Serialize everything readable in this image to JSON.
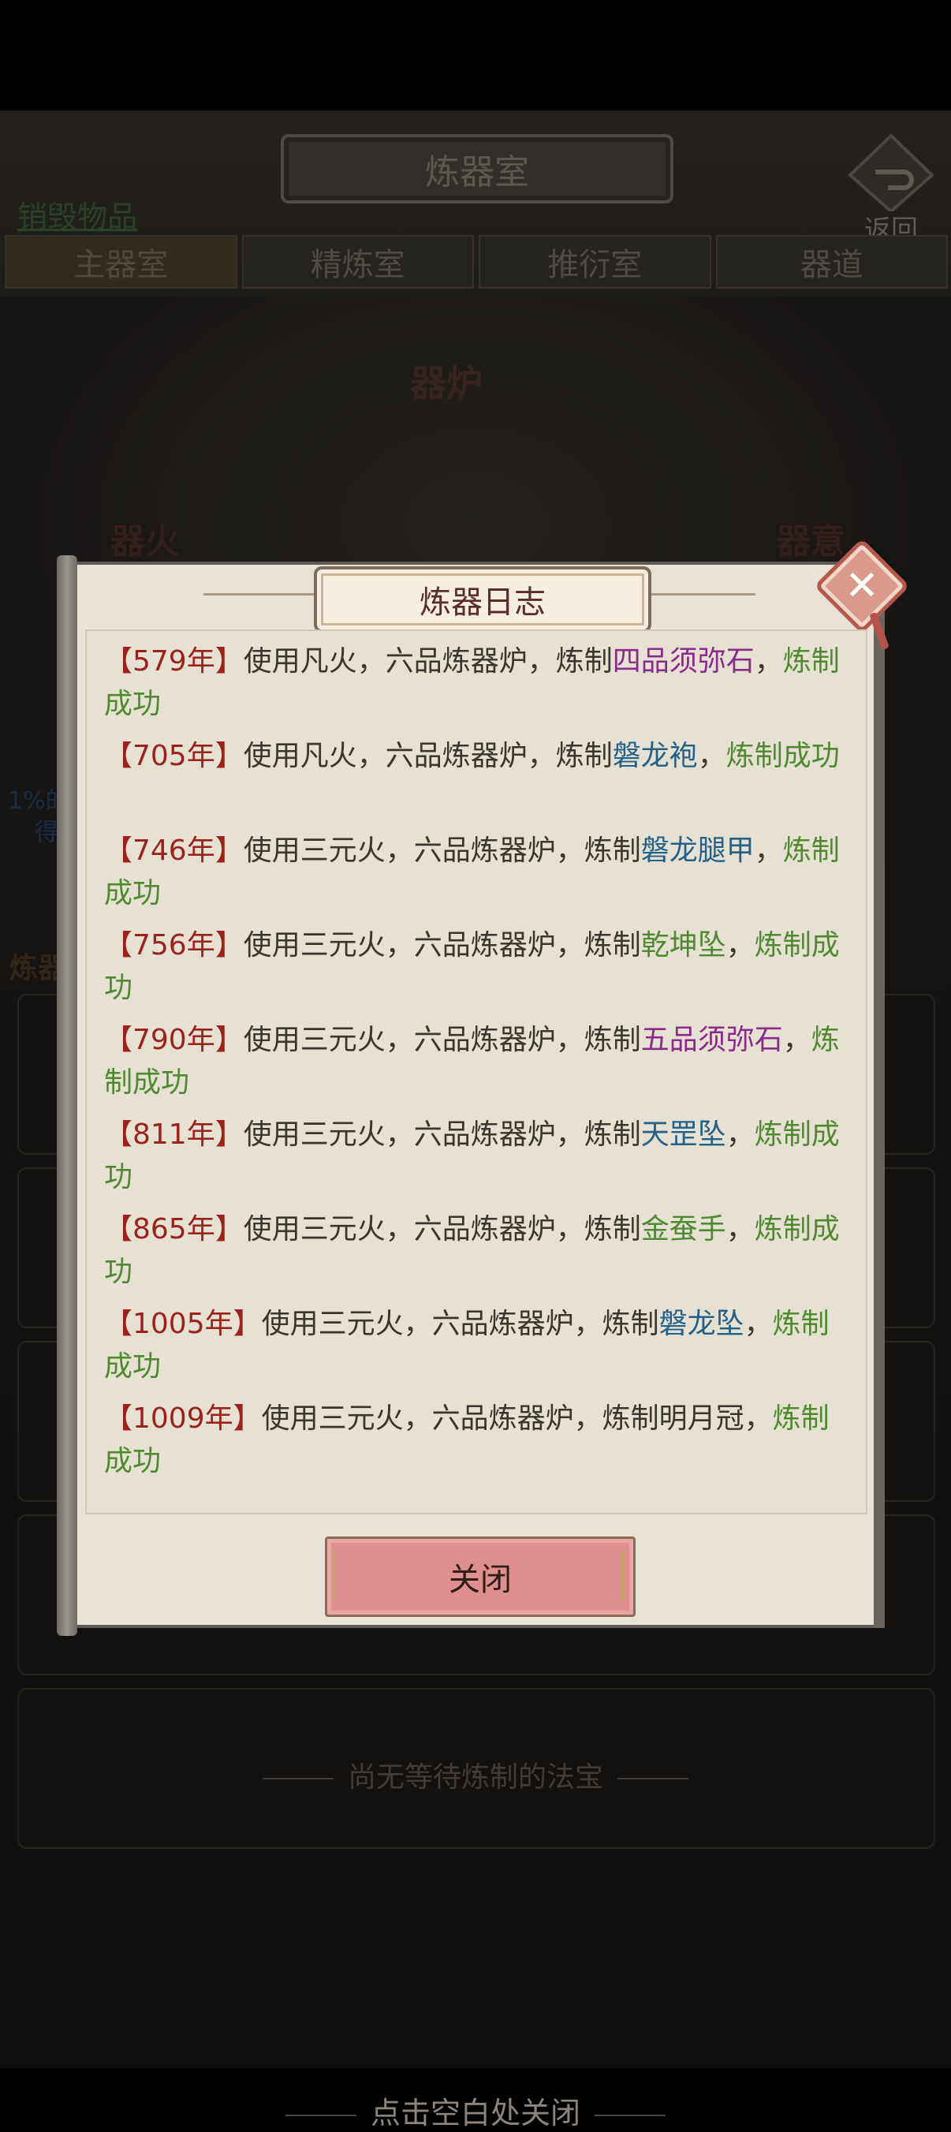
{
  "app": {
    "title": "炼器室",
    "back_label": "返回",
    "destroy_link": "销毁物品",
    "tabs": [
      "主器室",
      "精炼室",
      "推衍室",
      "器道"
    ],
    "furnace_label": "器炉",
    "fire_label": "器火",
    "essence_label": "器意",
    "hint_line_1": "1%的",
    "hint_line_2": "得",
    "section_label": "炼器",
    "empty_queue_text": "尚无等待炼制的法宝",
    "tap_to_close": "点击空白处关闭"
  },
  "dialog": {
    "title": "炼器日志",
    "close_button_label": "关闭",
    "entries": [
      {
        "year": "【579年】",
        "pre": "使用凡火，六品炼器炉，炼制",
        "item": "四品须弥石",
        "item_color": "purple",
        "post": "，",
        "result": "炼制成功"
      },
      {
        "year": "【705年】",
        "pre": "使用凡火，六品炼器炉，炼制",
        "item": "磐龙袍",
        "item_color": "blue",
        "post": "，",
        "result": "炼制成功"
      },
      {
        "year": "【746年】",
        "pre": "使用三元火，六品炼器炉，炼制",
        "item": "磐龙腿甲",
        "item_color": "blue",
        "post": "，",
        "result": "炼制成功"
      },
      {
        "year": "【756年】",
        "pre": "使用三元火，六品炼器炉，炼制",
        "item": "乾坤坠",
        "item_color": "green",
        "post": "，",
        "result": "炼制成功"
      },
      {
        "year": "【790年】",
        "pre": "使用三元火，六品炼器炉，炼制",
        "item": "五品须弥石",
        "item_color": "purple",
        "post": "，",
        "result": "炼制成功"
      },
      {
        "year": "【811年】",
        "pre": "使用三元火，六品炼器炉，炼制",
        "item": "天罡坠",
        "item_color": "blue",
        "post": "，",
        "result": "炼制成功"
      },
      {
        "year": "【865年】",
        "pre": "使用三元火，六品炼器炉，炼制",
        "item": "金蚕手",
        "item_color": "green",
        "post": "，",
        "result": "炼制成功"
      },
      {
        "year": "【1005年】",
        "pre": "使用三元火，六品炼器炉，炼制",
        "item": "磐龙坠",
        "item_color": "blue",
        "post": "，",
        "result": "炼制成功"
      },
      {
        "year": "【1009年】",
        "pre": "使用三元火，六品炼器炉，炼制",
        "item": "明月冠",
        "item_color": "plain",
        "post": "，",
        "result": "炼制成功"
      }
    ]
  },
  "colors": {
    "year": "#9a231b",
    "purple": "#8a2a8a",
    "blue": "#23608a",
    "green": "#4f8a30",
    "success": "#4f8a30"
  },
  "icons": {
    "close": "close-icon",
    "back": "back-arrow-icon"
  }
}
